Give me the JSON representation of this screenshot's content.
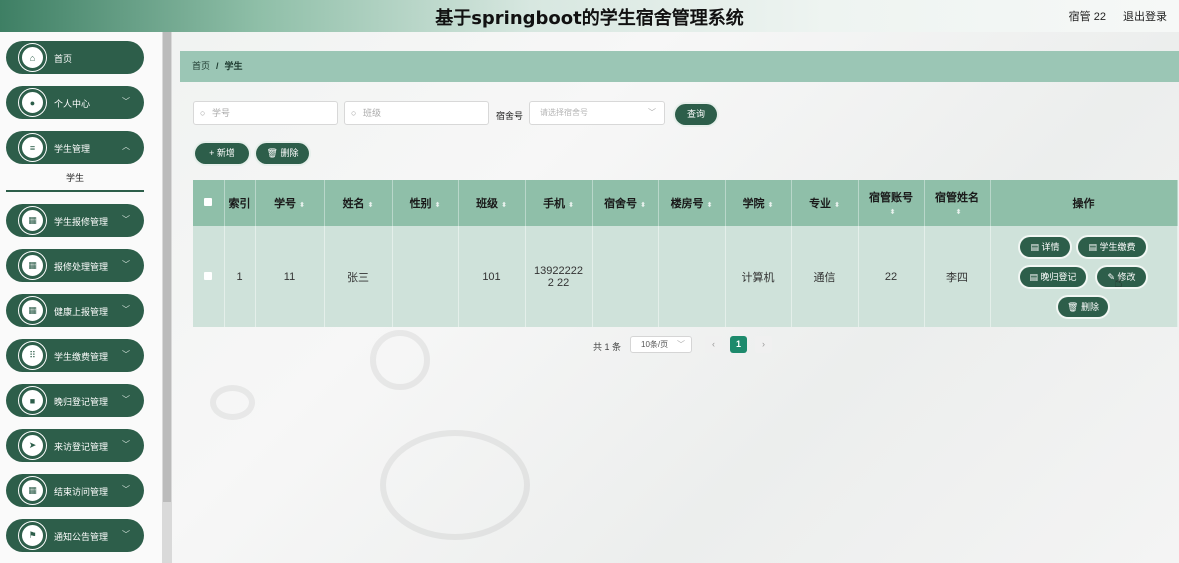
{
  "header": {
    "title": "基于springboot的学生宿舍管理系统",
    "user": "宿管 22",
    "logout": "退出登录"
  },
  "sidebar": {
    "items": [
      {
        "label": "首页",
        "icon": "home-icon",
        "glyph": "⌂",
        "chevron": false
      },
      {
        "label": "个人中心",
        "icon": "user-icon",
        "glyph": "●",
        "chevron": true
      },
      {
        "label": "学生管理",
        "icon": "list-icon",
        "glyph": "≡",
        "chevron": true
      },
      {
        "label": "学生报修管理",
        "icon": "grid-icon",
        "glyph": "▦",
        "chevron": true
      },
      {
        "label": "报修处理管理",
        "icon": "grid-icon",
        "glyph": "▦",
        "chevron": true
      },
      {
        "label": "健康上报管理",
        "icon": "grid-icon",
        "glyph": "▦",
        "chevron": true
      },
      {
        "label": "学生缴费管理",
        "icon": "apps-icon",
        "glyph": "⠿",
        "chevron": true
      },
      {
        "label": "晚归登记管理",
        "icon": "video-icon",
        "glyph": "■",
        "chevron": true
      },
      {
        "label": "来访登记管理",
        "icon": "send-icon",
        "glyph": "➤",
        "chevron": true
      },
      {
        "label": "结束访问管理",
        "icon": "grid-icon",
        "glyph": "▦",
        "chevron": true
      },
      {
        "label": "通知公告管理",
        "icon": "flag-icon",
        "glyph": "⚑",
        "chevron": true
      }
    ],
    "submenu": "学生"
  },
  "breadcrumb": {
    "home": "首页",
    "separator": "/",
    "current": "学生"
  },
  "search": {
    "student_no_placeholder": "学号",
    "class_placeholder": "班级",
    "dorm_label": "宿舍号",
    "dorm_placeholder": "请选择宿舍号",
    "query_button": "查询"
  },
  "actions": {
    "add": "+ 新增",
    "delete": "🗑 删除"
  },
  "table": {
    "headers": [
      "索引",
      "学号",
      "姓名",
      "性别",
      "班级",
      "手机",
      "宿舍号",
      "楼房号",
      "学院",
      "专业",
      "宿管账号",
      "宿管姓名",
      "操作"
    ],
    "rows": [
      {
        "index": "1",
        "student_no": "11",
        "name": "张三",
        "gender": "",
        "class": "101",
        "phone": "139222222 22",
        "dorm": "",
        "building": "",
        "college": "计算机",
        "major": "通信",
        "manager_account": "22",
        "manager_name": "李四",
        "ops": {
          "detail": "详情",
          "payment": "学生缴费",
          "late": "晚归登记",
          "edit": "修改",
          "delete": "删除"
        }
      }
    ]
  },
  "pagination": {
    "total": "共 1 条",
    "page_size": "10条/页",
    "current_page": "1"
  },
  "colors": {
    "primary": "#2d5e4a",
    "header_row": "#8fbfa9",
    "body_row": "#cfe2da",
    "breadcrumb_bg": "#9bc6b5"
  }
}
